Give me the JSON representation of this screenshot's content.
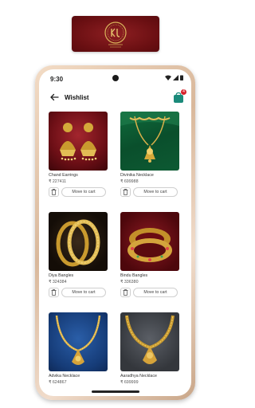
{
  "status": {
    "time": "9:30"
  },
  "header": {
    "title": "Wishlist",
    "cart_count": "4"
  },
  "products": [
    {
      "name": "Chand Earrings",
      "price": "₹ 227411",
      "action": "Move to cart"
    },
    {
      "name": "Divinika Necklace",
      "price": "₹ 699988",
      "action": "Move to cart"
    },
    {
      "name": "Diya Bangles",
      "price": "₹ 324384",
      "action": "Move to cart"
    },
    {
      "name": "Bindu Bangles",
      "price": "₹ 336380",
      "action": "Move to cart"
    },
    {
      "name": "Advika Necklace",
      "price": "₹ 624867",
      "action": "Move to cart"
    },
    {
      "name": "Aaradhya Necklace",
      "price": "₹ 699999",
      "action": "Move to cart"
    }
  ],
  "colors": {
    "brand": "#6a0f12",
    "gold": "#c9a032",
    "badge": "#d6212a"
  }
}
